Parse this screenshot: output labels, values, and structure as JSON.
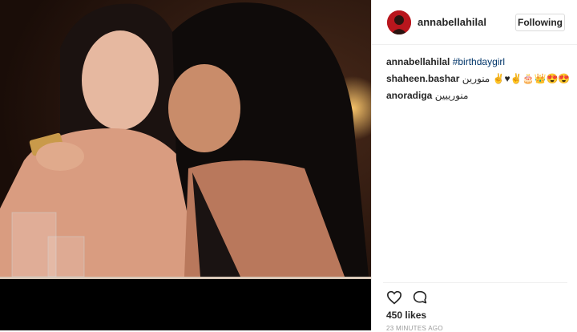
{
  "post": {
    "username": "annabellahilal",
    "follow_label": "Following",
    "avatar_color": "#b8161d",
    "photo_description_icon": "photo",
    "likes_label": "450 likes",
    "time_label": "23 MINUTES AGO"
  },
  "comments": [
    {
      "user": "annabellahilal",
      "tag": "#birthdaygirl",
      "text": ""
    },
    {
      "user": "shaheen.bashar",
      "tag": "",
      "text": "منورين ✌♥✌🎂👑😍😍"
    },
    {
      "user": "anoradiga",
      "tag": "",
      "text": "منورييين"
    }
  ],
  "actions": {
    "like_icon": "heart-icon",
    "comment_icon": "comment-icon"
  },
  "colors": {
    "link": "#003569",
    "border": "#efefef",
    "muted": "#999999"
  }
}
